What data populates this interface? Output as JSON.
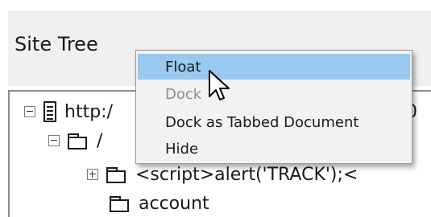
{
  "panel": {
    "title": "Site Tree"
  },
  "tree": {
    "nodes": [
      {
        "label": "http:/",
        "trailing": "0",
        "expander": "minus",
        "icon": "server-icon"
      },
      {
        "label": "/",
        "expander": "minus",
        "icon": "folder-open-icon"
      },
      {
        "label": "<script>alert('TRACK');<",
        "expander": "plus",
        "icon": "folder-icon"
      },
      {
        "label": "account",
        "expander": "none",
        "icon": "folder-icon"
      }
    ]
  },
  "context_menu": {
    "items": [
      {
        "label": "Float",
        "state": "highlighted"
      },
      {
        "label": "Dock",
        "state": "disabled"
      },
      {
        "label": "Dock as Tabbed Document",
        "state": "enabled"
      },
      {
        "label": "Hide",
        "state": "enabled"
      }
    ]
  },
  "colors": {
    "menu_highlight": "#99c9ef",
    "menu_background": "#f2f2f2",
    "panel_header": "#f0f0f0"
  }
}
